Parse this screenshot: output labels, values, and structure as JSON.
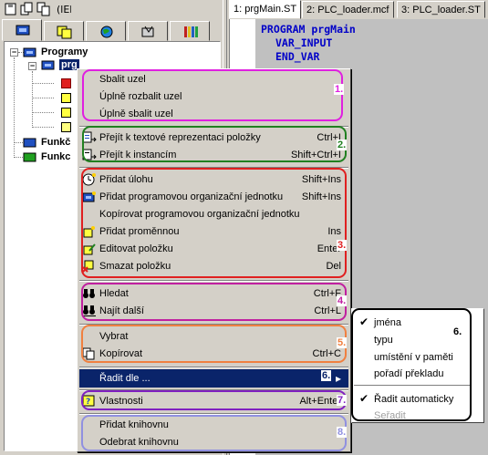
{
  "editor": {
    "tabs": [
      {
        "label": "1: prgMain.ST"
      },
      {
        "label": "2: PLC_loader.mcf"
      },
      {
        "label": "3: PLC_loader.ST"
      }
    ],
    "code_lines": [
      "PROGRAM prgMain",
      "VAR_INPUT",
      "END_VAR"
    ]
  },
  "tree": {
    "root_label": "Programy",
    "selected_prefix": "prg",
    "func1_label": "Funkč",
    "func2_label": "Funkc"
  },
  "menu": {
    "items": [
      {
        "label": "Sbalit uzel",
        "shortcut": ""
      },
      {
        "label": "Úplně rozbalit uzel",
        "shortcut": ""
      },
      {
        "label": "Úplně sbalit uzel",
        "shortcut": ""
      },
      {
        "label": "Přejít k textové reprezentaci položky",
        "shortcut": "Ctrl+I"
      },
      {
        "label": "Přejít k instancím",
        "shortcut": "Shift+Ctrl+I"
      },
      {
        "label": "Přidat úlohu",
        "shortcut": "Shift+Ins"
      },
      {
        "label": "Přidat programovou organizační jednotku",
        "shortcut": "Shift+Ins"
      },
      {
        "label": "Kopírovat programovou organizační jednotku",
        "shortcut": ""
      },
      {
        "label": "Přidat proměnnou",
        "shortcut": "Ins"
      },
      {
        "label": "Editovat položku",
        "shortcut": "Enter"
      },
      {
        "label": "Smazat položku",
        "shortcut": "Del"
      },
      {
        "label": "Hledat",
        "shortcut": "Ctrl+F"
      },
      {
        "label": "Najít další",
        "shortcut": "Ctrl+L"
      },
      {
        "label": "Vybrat",
        "shortcut": ""
      },
      {
        "label": "Kopírovat",
        "shortcut": "Ctrl+C"
      },
      {
        "label": "Řadit dle ...",
        "shortcut": ""
      },
      {
        "label": "Vlastnosti",
        "shortcut": "Alt+Enter"
      },
      {
        "label": "Přidat knihovnu",
        "shortcut": ""
      },
      {
        "label": "Odebrat knihovnu",
        "shortcut": ""
      }
    ],
    "group_numbers": [
      "1.",
      "2.",
      "3.",
      "4.",
      "5.",
      "6.",
      "7.",
      "8."
    ],
    "submenu_arrow": "▸"
  },
  "submenu": {
    "items": [
      {
        "label": "jména",
        "checked": "✔"
      },
      {
        "label": "typu",
        "checked": ""
      },
      {
        "label": "umístění v paměti",
        "checked": ""
      },
      {
        "label": "pořadí překladu",
        "checked": ""
      },
      {
        "label": "Řadit automaticky",
        "checked": "✔"
      },
      {
        "label": "Seřadit",
        "checked": ""
      }
    ],
    "group_number": "6."
  },
  "colors": {
    "group1": "#e020e0",
    "group2": "#208020",
    "group3": "#e02020",
    "group4": "#c020a0",
    "group5": "#f08040",
    "group7": "#8020c0",
    "group8": "#9090e0",
    "highlight": "#0a246a",
    "code": "#0000c8"
  }
}
